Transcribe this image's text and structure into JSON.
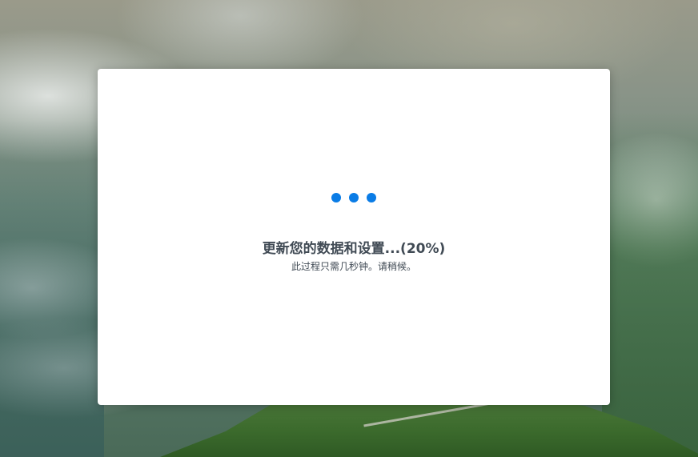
{
  "background": {
    "name": "misty-mountain-wallpaper"
  },
  "dialog": {
    "title": "更新您的数据和设置...(20%)",
    "subtitle": "此过程只需几秒钟。请稍候。",
    "progress_percent": 20,
    "spinner_color": "#0a7ce6"
  }
}
